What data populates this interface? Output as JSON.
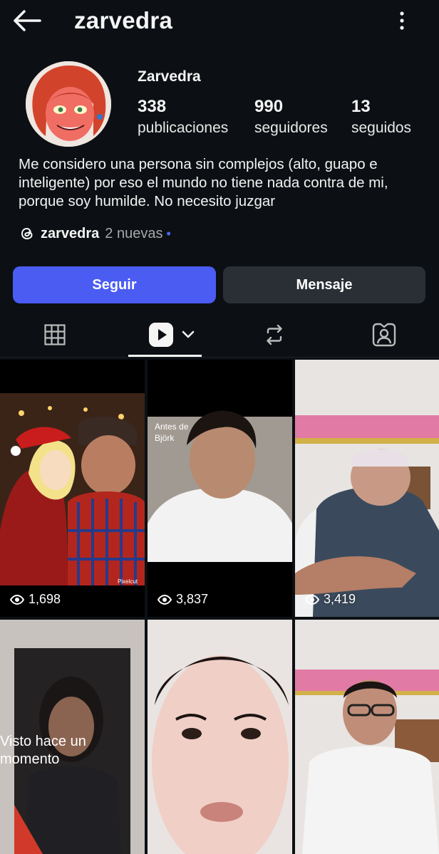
{
  "header": {
    "username": "zarvedra",
    "back_icon": "arrow-left-icon",
    "more_icon": "more-vertical-icon"
  },
  "profile": {
    "display_name": "Zarvedra",
    "stats": [
      {
        "value": "338",
        "label": "publicaciones"
      },
      {
        "value": "990",
        "label": "seguidores"
      },
      {
        "value": "13",
        "label": "seguidos"
      }
    ],
    "bio": "Me considero una persona sin complejos (alto, guapo e inteligente) por eso el mundo no tiene nada contra de mi, porque soy humilde. No necesito juzgar",
    "threads": {
      "handle": "zarvedra",
      "new": "2 nuevas",
      "dot": "•"
    }
  },
  "actions": {
    "follow": "Seguir",
    "message": "Mensaje"
  },
  "tabs": [
    "grid-icon",
    "reels-icon",
    "reposts-icon",
    "tagged-icon"
  ],
  "colors": {
    "background": "#0c1014",
    "accent": "#4a5cf2",
    "secondary_button": "#2a2f35",
    "threads_dot": "#4a6cf7"
  },
  "grid": [
    {
      "views": "1,698",
      "caption": "",
      "watermark": "Pixelcut"
    },
    {
      "views": "3,837",
      "caption": "Antes de Björk"
    },
    {
      "views": "3,419",
      "caption": ""
    },
    {
      "views": "",
      "caption": "Visto hace un momento"
    },
    {
      "views": "",
      "caption": ""
    },
    {
      "views": "",
      "caption": ""
    }
  ]
}
